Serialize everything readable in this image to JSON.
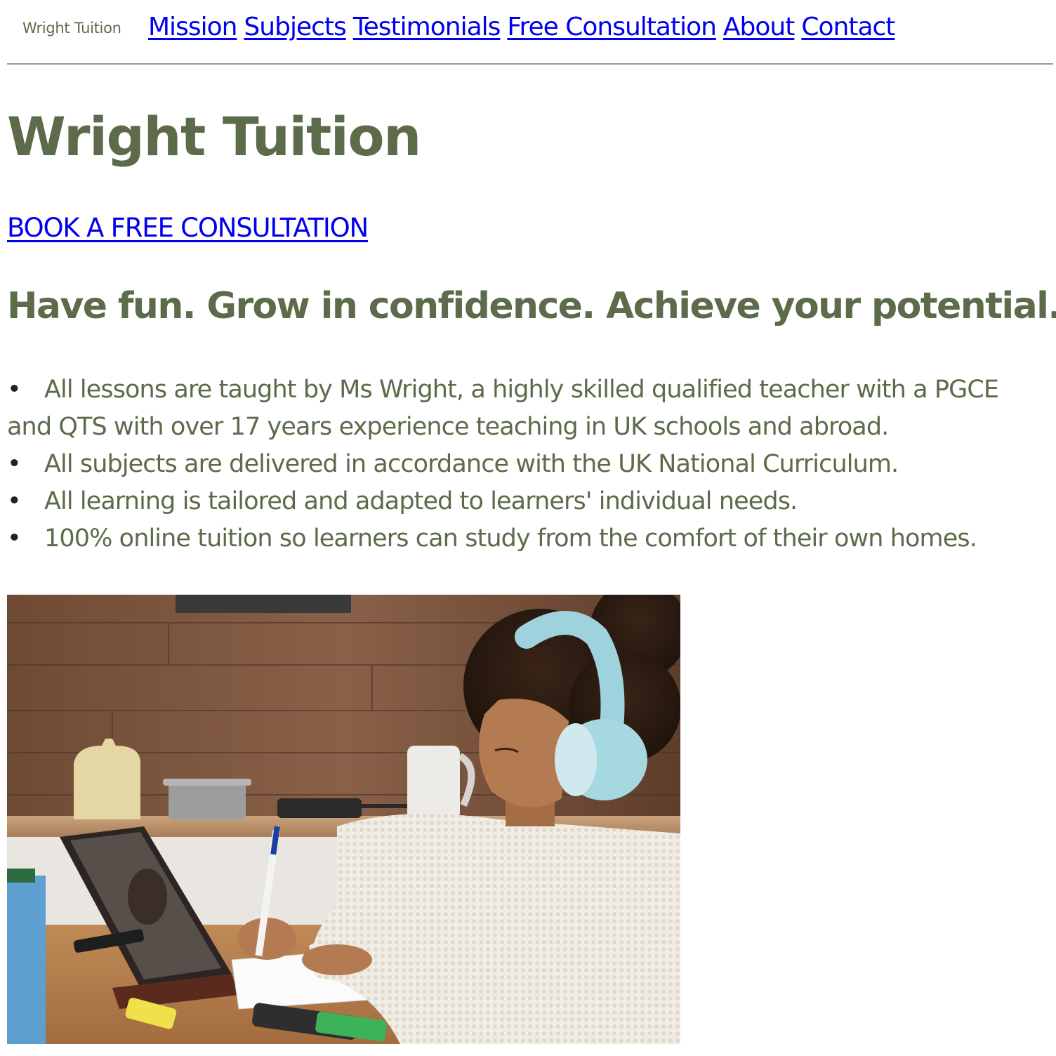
{
  "header": {
    "logo_text": "Wright Tuition",
    "nav": [
      {
        "label": "Mission"
      },
      {
        "label": "Subjects"
      },
      {
        "label": "Testimonials"
      },
      {
        "label": "Free Consultation"
      },
      {
        "label": "About"
      },
      {
        "label": "Contact"
      }
    ]
  },
  "main": {
    "title": "Wright Tuition",
    "cta_label": "BOOK A FREE CONSULTATION",
    "tagline": "Have fun. Grow in confidence. Achieve your potential.",
    "bullet_glyph": "•",
    "features": [
      "All lessons are taught by Ms Wright, a highly skilled qualified teacher with a PGCE and QTS with over 17 years experience teaching in UK schools and abroad.",
      "All subjects are delivered in accordance with the UK National Curriculum.",
      "All learning is tailored and adapted to learners' individual needs.",
      "100% online tuition so learners can study from the comfort of their own homes."
    ]
  },
  "colors": {
    "brand_green": "#5c6b4a",
    "link_blue": "#0000ee",
    "divider": "#9a9a9a"
  }
}
